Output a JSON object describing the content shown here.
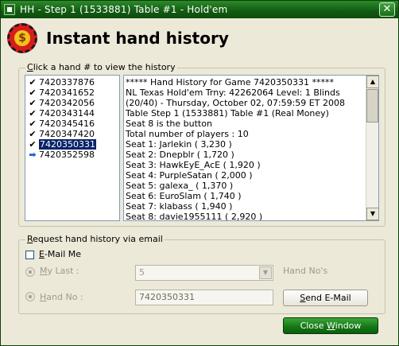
{
  "window": {
    "title": "HH - Step 1 (1533881) Table #1 - Hold'em",
    "close_label": "✕"
  },
  "logo": {
    "glyph": "$"
  },
  "heading": "Instant hand history",
  "hands_group": {
    "legend_prefix": "",
    "legend_mnemonic": "C",
    "legend_rest": "lick a hand # to view the history"
  },
  "hands": [
    {
      "number": "7420337876",
      "mark": "✔",
      "state": "viewed"
    },
    {
      "number": "7420341652",
      "mark": "✔",
      "state": "viewed"
    },
    {
      "number": "7420342056",
      "mark": "✔",
      "state": "viewed"
    },
    {
      "number": "7420343144",
      "mark": "✔",
      "state": "viewed"
    },
    {
      "number": "7420345416",
      "mark": "✔",
      "state": "viewed"
    },
    {
      "number": "7420347420",
      "mark": "✔",
      "state": "viewed"
    },
    {
      "number": "7420350331",
      "mark": "✔",
      "state": "selected"
    },
    {
      "number": "7420352598",
      "mark": "➡",
      "state": "current"
    }
  ],
  "history_lines": [
    "***** Hand History for Game 7420350331 *****",
    "NL Texas Hold'em  Trny: 42262064 Level: 1  Blinds",
    "(20/40) - Thursday, October 02, 07:59:59 ET 2008",
    "Table Step 1 (1533881) Table #1 (Real Money)",
    "Seat 8 is the button",
    "Total number of players : 10",
    "Seat 1: Jarlekin ( 3,230 )",
    "Seat 2: Dnepblr ( 1,720 )",
    "Seat 3: HawkEyE_AcE ( 1,920 )",
    "Seat 4: PurpleSatan ( 2,000 )",
    "Seat 5: galexa_ ( 1,370 )",
    "Seat 6: EuroSlam ( 1,740 )",
    "Seat 7: klabass ( 1,940 )",
    "Seat 8: davie1955111 ( 2,920 )"
  ],
  "email_group": {
    "legend_prefix": "",
    "legend_mnemonic": "R",
    "legend_rest": "equest hand history via email",
    "email_me": {
      "mnemonic": "E",
      "rest": "-Mail Me",
      "checked": false
    },
    "my_last": {
      "mnemonic": "M",
      "rest": "y Last  :",
      "value": "5",
      "suffix": "Hand No's"
    },
    "hand_no": {
      "mnemonic": "H",
      "rest": "and No  :",
      "value": "7420350331"
    },
    "send_button": {
      "mnemonic": "S",
      "rest": "end E-Mail"
    }
  },
  "close_window_button": {
    "prefix": "Close ",
    "mnemonic": "W",
    "rest": "indow"
  }
}
